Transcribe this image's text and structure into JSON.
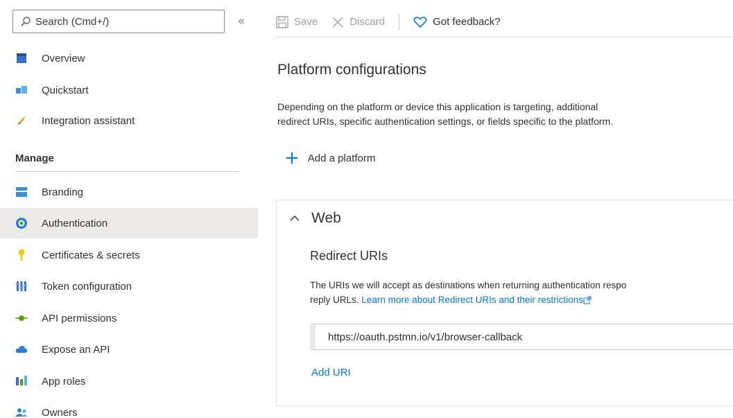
{
  "sidebar": {
    "search_placeholder": "Search (Cmd+/)",
    "collapse_glyph": "«",
    "top_items": [
      {
        "label": "Overview",
        "icon": "overview-icon"
      },
      {
        "label": "Quickstart",
        "icon": "quickstart-icon"
      },
      {
        "label": "Integration assistant",
        "icon": "rocket-icon"
      }
    ],
    "manage_header": "Manage",
    "manage_items": [
      {
        "label": "Branding",
        "icon": "branding-icon"
      },
      {
        "label": "Authentication",
        "icon": "authentication-icon",
        "selected": true
      },
      {
        "label": "Certificates & secrets",
        "icon": "key-icon"
      },
      {
        "label": "Token configuration",
        "icon": "token-icon"
      },
      {
        "label": "API permissions",
        "icon": "api-permissions-icon"
      },
      {
        "label": "Expose an API",
        "icon": "cloud-icon"
      },
      {
        "label": "App roles",
        "icon": "app-roles-icon"
      },
      {
        "label": "Owners",
        "icon": "owners-icon"
      }
    ]
  },
  "toolbar": {
    "save_label": "Save",
    "discard_label": "Discard",
    "feedback_label": "Got feedback?"
  },
  "main": {
    "title": "Platform configurations",
    "description_line1": "Depending on the platform or device this application is targeting, additional",
    "description_line2": "redirect URIs, specific authentication settings, or fields specific to the platform.",
    "add_platform_label": "Add a platform",
    "web_card": {
      "header": "Web",
      "redirect_title": "Redirect URIs",
      "redirect_desc_line1": "The URIs we will accept as destinations when returning authentication respo",
      "redirect_desc_line2_prefix": "reply URLs.",
      "learn_more_link": "Learn more about Redirect URIs and their restrictions",
      "redirect_uri_value": "https://oauth.pstmn.io/v1/browser-callback",
      "add_uri_label": "Add URI"
    }
  },
  "colors": {
    "accent": "#0078d4",
    "selected_bg": "#edebe9",
    "border": "#c8c6c4"
  }
}
